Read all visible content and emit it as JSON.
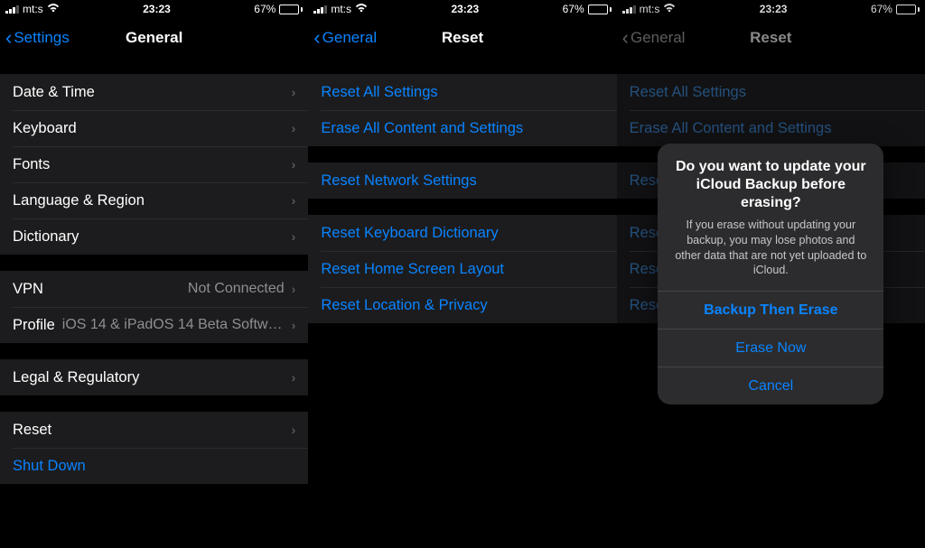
{
  "status": {
    "carrier": "mt:s",
    "time": "23:23",
    "battery_pct": "67%"
  },
  "screen1": {
    "back_label": "Settings",
    "title": "General",
    "group1": [
      "Date & Time",
      "Keyboard",
      "Fonts",
      "Language & Region",
      "Dictionary"
    ],
    "vpn_label": "VPN",
    "vpn_detail": "Not Connected",
    "profile_label": "Profile",
    "profile_detail": "iOS 14 & iPadOS 14 Beta Softwar...",
    "legal_label": "Legal & Regulatory",
    "reset_label": "Reset",
    "shutdown_label": "Shut Down"
  },
  "screen2": {
    "back_label": "General",
    "title": "Reset",
    "group1": [
      "Reset All Settings",
      "Erase All Content and Settings"
    ],
    "group2": [
      "Reset Network Settings"
    ],
    "group3": [
      "Reset Keyboard Dictionary",
      "Reset Home Screen Layout",
      "Reset Location & Privacy"
    ]
  },
  "screen3": {
    "back_label": "General",
    "title": "Reset",
    "group1": [
      "Reset All Settings",
      "Erase All Content and Settings"
    ],
    "group2_trunc": "Rese",
    "group3_trunc": [
      "Rese",
      "Rese",
      "Rese"
    ],
    "alert": {
      "title": "Do you want to update your iCloud Backup before erasing?",
      "message": "If you erase without updating your backup, you may lose photos and other data that are not yet uploaded to iCloud.",
      "btn_primary": "Backup Then Erase",
      "btn_erase": "Erase Now",
      "btn_cancel": "Cancel"
    }
  }
}
